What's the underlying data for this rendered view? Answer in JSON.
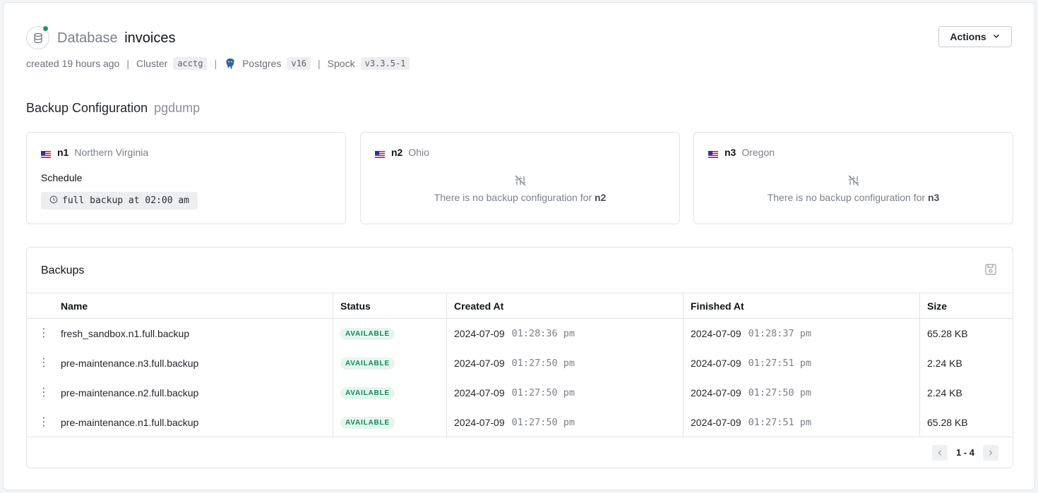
{
  "header": {
    "title_prefix": "Database",
    "title_name": "invoices",
    "created": "created 19 hours ago",
    "cluster_label": "Cluster",
    "cluster_value": "acctg",
    "engine_label": "Postgres",
    "engine_version": "v16",
    "extension_label": "Spock",
    "extension_version": "v3.3.5-1",
    "separator": "|",
    "actions_label": "Actions"
  },
  "backup_config": {
    "title": "Backup Configuration",
    "method": "pgdump",
    "nodes": [
      {
        "id": "n1",
        "region": "Northern Virginia",
        "schedule_label": "Schedule",
        "schedule": "full backup at 02:00 am"
      },
      {
        "id": "n2",
        "region": "Ohio",
        "empty_text": "There is no backup configuration for",
        "empty_node": "n2"
      },
      {
        "id": "n3",
        "region": "Oregon",
        "empty_text": "There is no backup configuration for",
        "empty_node": "n3"
      }
    ]
  },
  "backups": {
    "title": "Backups",
    "columns": [
      "Name",
      "Status",
      "Created At",
      "Finished At",
      "Size"
    ],
    "rows": [
      {
        "name": "fresh_sandbox.n1.full.backup",
        "status": "AVAILABLE",
        "created_date": "2024-07-09",
        "created_time": "01:28:36 pm",
        "finished_date": "2024-07-09",
        "finished_time": "01:28:37 pm",
        "size": "65.28 KB"
      },
      {
        "name": "pre-maintenance.n3.full.backup",
        "status": "AVAILABLE",
        "created_date": "2024-07-09",
        "created_time": "01:27:50 pm",
        "finished_date": "2024-07-09",
        "finished_time": "01:27:51 pm",
        "size": "2.24 KB"
      },
      {
        "name": "pre-maintenance.n2.full.backup",
        "status": "AVAILABLE",
        "created_date": "2024-07-09",
        "created_time": "01:27:50 pm",
        "finished_date": "2024-07-09",
        "finished_time": "01:27:50 pm",
        "size": "2.24 KB"
      },
      {
        "name": "pre-maintenance.n1.full.backup",
        "status": "AVAILABLE",
        "created_date": "2024-07-09",
        "created_time": "01:27:50 pm",
        "finished_date": "2024-07-09",
        "finished_time": "01:27:51 pm",
        "size": "65.28 KB"
      }
    ],
    "pagination": "1 - 4"
  },
  "colors": {
    "status_online": "#0e9f6e",
    "badge_text": "#0d8a5a",
    "badge_bg": "#e6f6ee"
  },
  "icons": {
    "database": "database-icon",
    "postgres": "postgres-elephant-icon",
    "flag": "us-flag-icon",
    "clock": "clock-icon",
    "no_config": "sliders-off-icon",
    "save": "save-icon",
    "row_menu": "kebab-menu-icon"
  }
}
